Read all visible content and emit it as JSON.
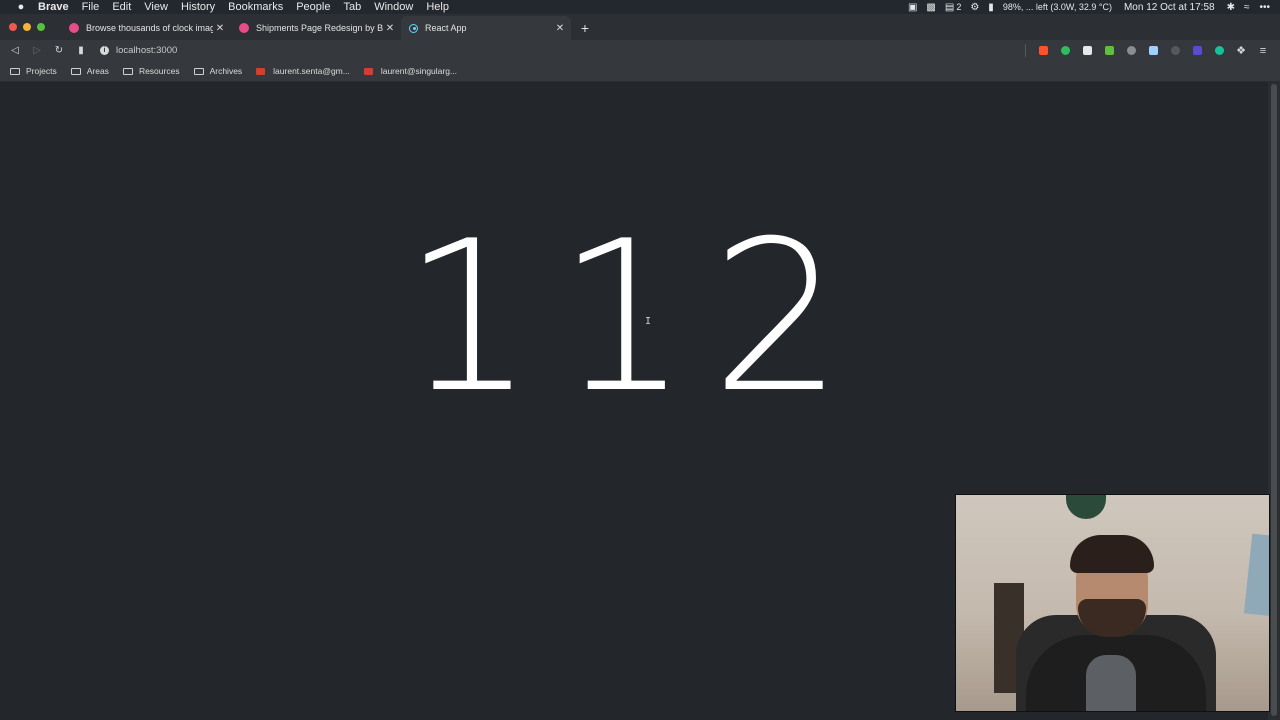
{
  "menubar": {
    "app": "Brave",
    "menus": [
      "File",
      "Edit",
      "View",
      "History",
      "Bookmarks",
      "People",
      "Tab",
      "Window",
      "Help"
    ],
    "status_count": "2",
    "battery_text": "98%, ... left (3.0W, 32.9 °C)",
    "clock": "Mon 12 Oct at 17:58"
  },
  "tabs": [
    {
      "title": "Browse thousands of clock imag",
      "favicon": "dribbble-icon",
      "active": false
    },
    {
      "title": "Shipments Page Redesign by Be",
      "favicon": "dribbble-icon",
      "active": false
    },
    {
      "title": "React App",
      "favicon": "react-icon",
      "active": true
    }
  ],
  "toolbar": {
    "url": "localhost:3000"
  },
  "bookmarks": [
    {
      "label": "Projects",
      "icon": "folder-icon"
    },
    {
      "label": "Areas",
      "icon": "folder-icon"
    },
    {
      "label": "Resources",
      "icon": "folder-icon"
    },
    {
      "label": "Archives",
      "icon": "folder-icon"
    },
    {
      "label": "laurent.senta@gm...",
      "icon": "gmail-icon"
    },
    {
      "label": "laurent@singularg...",
      "icon": "gmail-icon"
    }
  ],
  "page": {
    "counter": "112"
  },
  "colors": {
    "page_background": "#23272b",
    "counter_text": "#ffffff",
    "toolbar": "#35383c",
    "brave_accent": "#fb542b"
  }
}
